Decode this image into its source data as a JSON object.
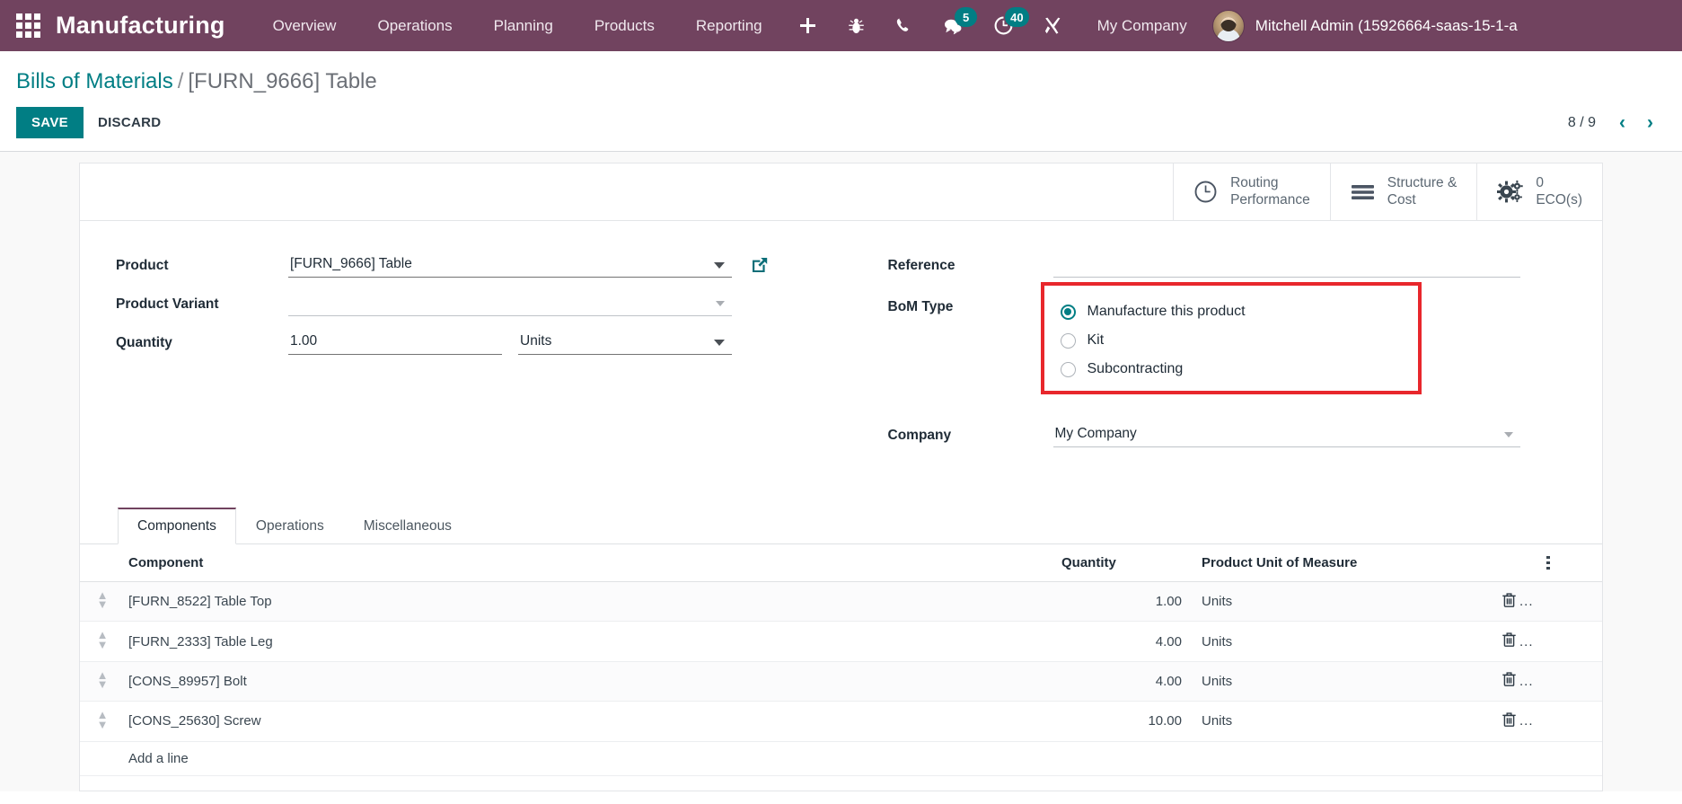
{
  "navbar": {
    "apps_icon": "grid-apps-icon",
    "brand": "Manufacturing",
    "menu": [
      {
        "label": "Overview"
      },
      {
        "label": "Operations"
      },
      {
        "label": "Planning"
      },
      {
        "label": "Products"
      },
      {
        "label": "Reporting"
      }
    ],
    "icons": [
      {
        "name": "plus-icon",
        "glyph": "+"
      },
      {
        "name": "bug-icon",
        "glyph": "bug"
      },
      {
        "name": "phone-icon",
        "glyph": "phone"
      },
      {
        "name": "chat-icon",
        "glyph": "chat",
        "badge": "5"
      },
      {
        "name": "activity-clock-icon",
        "glyph": "clock",
        "badge": "40"
      },
      {
        "name": "tools-icon",
        "glyph": "tools"
      }
    ],
    "chat_badge": "5",
    "activity_badge": "40",
    "company": "My Company",
    "username": "Mitchell Admin (15926664-saas-15-1-a",
    "bg_color": "#71435f",
    "badge_color": "#017e84"
  },
  "control_panel": {
    "breadcrumb_root": "Bills of Materials",
    "breadcrumb_sep": "/",
    "breadcrumb_current": "[FURN_9666] Table",
    "save_label": "SAVE",
    "discard_label": "DISCARD",
    "pager_count": "8 / 9",
    "pager_prev": "‹",
    "pager_next": "›",
    "accent_color": "#017e84"
  },
  "smart_buttons": [
    {
      "icon": "clock-icon",
      "label_line1": "Routing",
      "label_line2": "Performance"
    },
    {
      "icon": "list-lines-icon",
      "label_line1": "Structure &",
      "label_line2": "Cost"
    },
    {
      "icon": "gears-icon",
      "label_line1": "0",
      "label_line2": "ECO(s)"
    }
  ],
  "form": {
    "left": {
      "product_label": "Product",
      "product_value": "[FURN_9666] Table",
      "product_variant_label": "Product Variant",
      "product_variant_value": "",
      "quantity_label": "Quantity",
      "quantity_value": "1.00",
      "uom_value": "Units"
    },
    "right": {
      "reference_label": "Reference",
      "reference_value": "",
      "bom_type_label": "BoM Type",
      "bom_type_options": [
        {
          "label": "Manufacture this product",
          "selected": true
        },
        {
          "label": "Kit",
          "selected": false
        },
        {
          "label": "Subcontracting",
          "selected": false
        }
      ],
      "company_label": "Company",
      "company_value": "My Company",
      "highlight_color": "#e8272c"
    }
  },
  "notebook": {
    "tabs": [
      {
        "label": "Components",
        "active": true
      },
      {
        "label": "Operations",
        "active": false
      },
      {
        "label": "Miscellaneous",
        "active": false
      }
    ]
  },
  "components_table": {
    "columns": {
      "component": "Component",
      "quantity": "Quantity",
      "uom": "Product Unit of Measure"
    },
    "rows": [
      {
        "component": "[FURN_8522] Table Top",
        "quantity": "1.00",
        "uom": "Units"
      },
      {
        "component": "[FURN_2333] Table Leg",
        "quantity": "4.00",
        "uom": "Units"
      },
      {
        "component": "[CONS_89957] Bolt",
        "quantity": "4.00",
        "uom": "Units"
      },
      {
        "component": "[CONS_25630] Screw",
        "quantity": "10.00",
        "uom": "Units"
      }
    ],
    "add_line_label": "Add a line",
    "row_delete_suffix": "..."
  }
}
